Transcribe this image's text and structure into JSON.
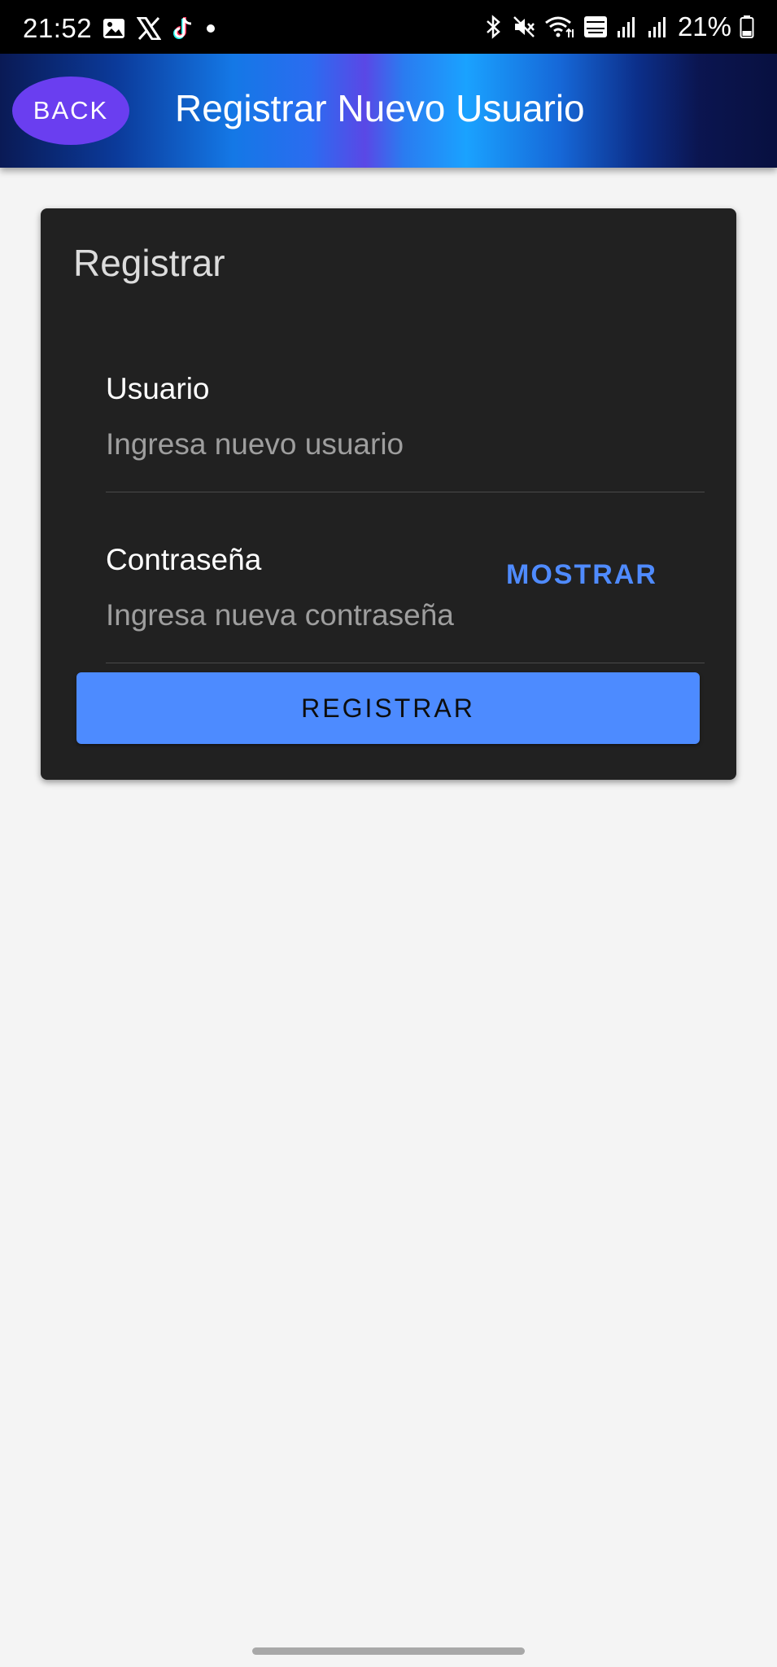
{
  "status_bar": {
    "time": "21:52",
    "battery": "21%",
    "left_icons": [
      "gallery-icon",
      "x-logo-icon",
      "tiktok-icon",
      "notification-dot-icon"
    ],
    "right_icons": [
      "bluetooth-icon",
      "mute-icon",
      "wifi-icon",
      "volte-icon",
      "signal-icon",
      "signal-icon",
      "battery-icon"
    ]
  },
  "header": {
    "back_label": "BACK",
    "title": "Registrar Nuevo Usuario"
  },
  "card": {
    "title": "Registrar",
    "username": {
      "label": "Usuario",
      "placeholder": "Ingresa nuevo usuario"
    },
    "password": {
      "label": "Contraseña",
      "placeholder": "Ingresa nueva contraseña",
      "show_label": "MOSTRAR"
    },
    "submit_label": "REGISTRAR"
  },
  "colors": {
    "accent": "#4d8bff",
    "back_button": "#6a3ef0",
    "card_background": "#212121",
    "page_background": "#f4f4f4"
  }
}
